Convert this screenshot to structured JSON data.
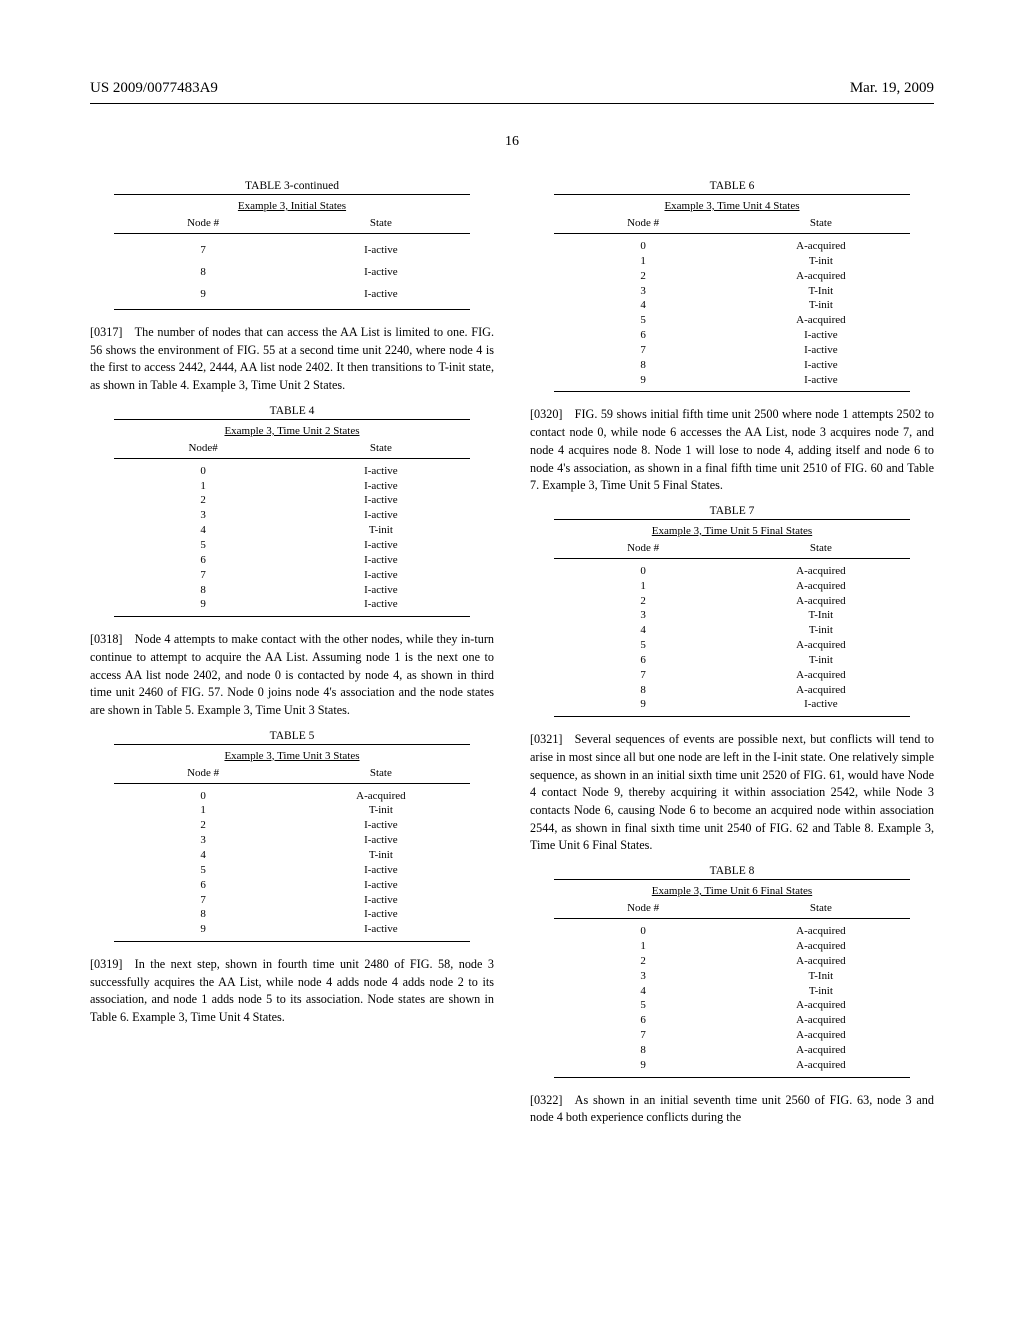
{
  "header": {
    "left": "US 2009/0077483A9",
    "right": "Mar. 19, 2009",
    "page": "16"
  },
  "col_head": {
    "node": "Node #",
    "nodeh": "Node#",
    "state": "State"
  },
  "t3": {
    "title": "TABLE 3-continued",
    "sub": "Example 3, Initial States",
    "rows": [
      {
        "n": "7",
        "s": "I-active"
      },
      {
        "n": "8",
        "s": "I-active"
      },
      {
        "n": "9",
        "s": "I-active"
      }
    ]
  },
  "p0317": "[0317] The number of nodes that can access the AA List is limited to one. FIG. 56 shows the environment of FIG. 55 at a second time unit 2240, where node 4 is the first to access 2442, 2444, AA list node 2402. It then transitions to T-init state, as shown in Table 4. Example 3, Time Unit 2 States.",
  "t4": {
    "title": "TABLE 4",
    "sub": "Example 3, Time Unit 2 States",
    "rows": [
      {
        "n": "0",
        "s": "I-active"
      },
      {
        "n": "1",
        "s": "I-active"
      },
      {
        "n": "2",
        "s": "I-active"
      },
      {
        "n": "3",
        "s": "I-active"
      },
      {
        "n": "4",
        "s": "T-init"
      },
      {
        "n": "5",
        "s": "I-active"
      },
      {
        "n": "6",
        "s": "I-active"
      },
      {
        "n": "7",
        "s": "I-active"
      },
      {
        "n": "8",
        "s": "I-active"
      },
      {
        "n": "9",
        "s": "I-active"
      }
    ]
  },
  "p0318": "[0318] Node 4 attempts to make contact with the other nodes, while they in-turn continue to attempt to acquire the AA List. Assuming node 1 is the next one to access AA list node 2402, and node 0 is contacted by node 4, as shown in third time unit 2460 of FIG. 57. Node 0 joins node 4's association and the node states are shown in Table 5. Example 3, Time Unit 3 States.",
  "t5": {
    "title": "TABLE 5",
    "sub": "Example 3, Time Unit 3 States",
    "rows": [
      {
        "n": "0",
        "s": "A-acquired"
      },
      {
        "n": "1",
        "s": "T-init"
      },
      {
        "n": "2",
        "s": "I-active"
      },
      {
        "n": "3",
        "s": "I-active"
      },
      {
        "n": "4",
        "s": "T-init"
      },
      {
        "n": "5",
        "s": "I-active"
      },
      {
        "n": "6",
        "s": "I-active"
      },
      {
        "n": "7",
        "s": "I-active"
      },
      {
        "n": "8",
        "s": "I-active"
      },
      {
        "n": "9",
        "s": "I-active"
      }
    ]
  },
  "p0319": "[0319] In the next step, shown in fourth time unit 2480 of FIG. 58, node 3 successfully acquires the AA List, while node 4 adds node 4 adds node 2 to its association, and node 1 adds node 5 to its association. Node states are shown in Table 6. Example 3, Time Unit 4 States.",
  "t6": {
    "title": "TABLE 6",
    "sub": "Example 3, Time Unit 4 States",
    "rows": [
      {
        "n": "0",
        "s": "A-acquired"
      },
      {
        "n": "1",
        "s": "T-init"
      },
      {
        "n": "2",
        "s": "A-acquired"
      },
      {
        "n": "3",
        "s": "T-Init"
      },
      {
        "n": "4",
        "s": "T-init"
      },
      {
        "n": "5",
        "s": "A-acquired"
      },
      {
        "n": "6",
        "s": "I-active"
      },
      {
        "n": "7",
        "s": "I-active"
      },
      {
        "n": "8",
        "s": "I-active"
      },
      {
        "n": "9",
        "s": "I-active"
      }
    ]
  },
  "p0320": "[0320] FIG. 59 shows initial fifth time unit 2500 where node 1 attempts 2502 to contact node 0, while node 6 accesses the AA List, node 3 acquires node 7, and node 4 acquires node 8. Node 1 will lose to node 4, adding itself and node 6 to node 4's association, as shown in a final fifth time unit 2510 of FIG. 60 and Table 7. Example 3, Time Unit 5 Final States.",
  "t7": {
    "title": "TABLE 7",
    "sub": "Example 3, Time Unit 5 Final States",
    "rows": [
      {
        "n": "0",
        "s": "A-acquired"
      },
      {
        "n": "1",
        "s": "A-acquired"
      },
      {
        "n": "2",
        "s": "A-acquired"
      },
      {
        "n": "3",
        "s": "T-Init"
      },
      {
        "n": "4",
        "s": "T-init"
      },
      {
        "n": "5",
        "s": "A-acquired"
      },
      {
        "n": "6",
        "s": "T-init"
      },
      {
        "n": "7",
        "s": "A-acquired"
      },
      {
        "n": "8",
        "s": "A-acquired"
      },
      {
        "n": "9",
        "s": "I-active"
      }
    ]
  },
  "p0321": "[0321] Several sequences of events are possible next, but conflicts will tend to arise in most since all but one node are left in the I-init state. One relatively simple sequence, as shown in an initial sixth time unit 2520 of FIG. 61, would have Node 4 contact Node 9, thereby acquiring it within association 2542, while Node 3 contacts Node 6, causing Node 6 to become an acquired node within association 2544, as shown in final sixth time unit 2540 of FIG. 62 and Table 8. Example 3, Time Unit 6 Final States.",
  "t8": {
    "title": "TABLE 8",
    "sub": "Example 3, Time Unit 6 Final States",
    "rows": [
      {
        "n": "0",
        "s": "A-acquired"
      },
      {
        "n": "1",
        "s": "A-acquired"
      },
      {
        "n": "2",
        "s": "A-acquired"
      },
      {
        "n": "3",
        "s": "T-Init"
      },
      {
        "n": "4",
        "s": "T-init"
      },
      {
        "n": "5",
        "s": "A-acquired"
      },
      {
        "n": "6",
        "s": "A-acquired"
      },
      {
        "n": "7",
        "s": "A-acquired"
      },
      {
        "n": "8",
        "s": "A-acquired"
      },
      {
        "n": "9",
        "s": "A-acquired"
      }
    ]
  },
  "p0322": "[0322] As shown in an initial seventh time unit 2560 of FIG. 63, node 3 and node 4 both experience conflicts during the"
}
